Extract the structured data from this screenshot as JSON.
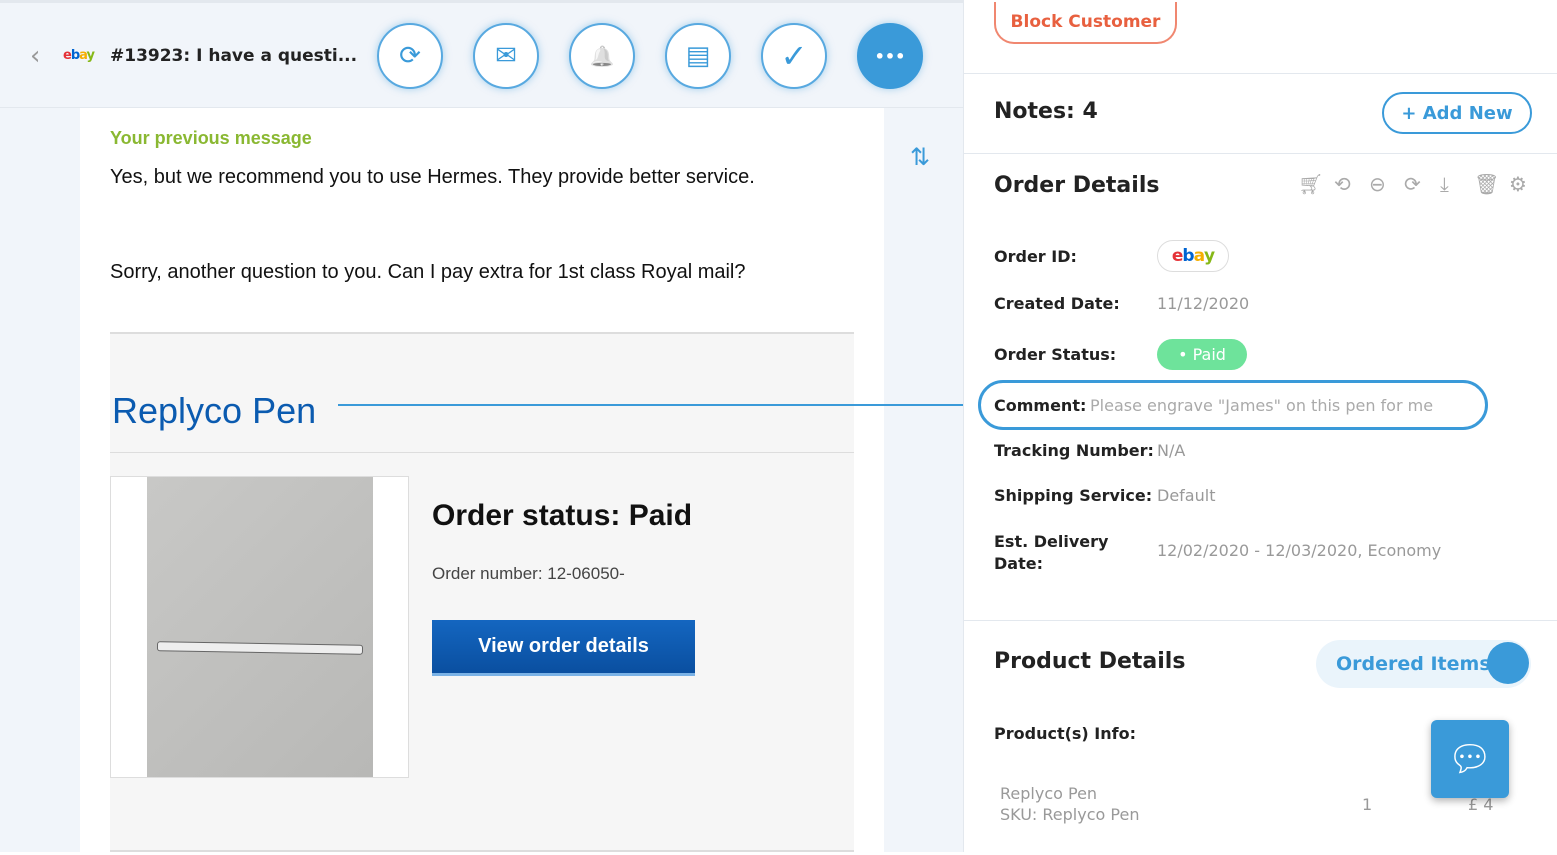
{
  "header": {
    "back": "‹",
    "source": "ebay",
    "title": "#13923: I have a questi...",
    "actions": [
      {
        "name": "refresh",
        "glyph": "⟳"
      },
      {
        "name": "mail",
        "glyph": "✉"
      },
      {
        "name": "snooze",
        "glyph": "🔔"
      },
      {
        "name": "archive",
        "glyph": "▤"
      },
      {
        "name": "resolve",
        "glyph": "✓"
      },
      {
        "name": "reply",
        "glyph": "•••"
      }
    ]
  },
  "message": {
    "previous_label": "Your previous message",
    "previous_text": "Yes, but we recommend you to use Hermes. They provide better service.",
    "new_text": "Sorry, another question to you. Can I pay extra for 1st class Royal mail?",
    "product_title": "Replyco Pen",
    "order_status": "Order status: Paid",
    "order_number": "Order number: 12-06050-",
    "view_button": "View order details",
    "sort_icon": "⇅"
  },
  "sidebar": {
    "block_button": "Block Customer",
    "notes_label": "Notes: 4",
    "add_new": "+ Add New",
    "order_details_title": "Order Details",
    "order_icons": [
      "cart",
      "reorder",
      "exchange",
      "refund",
      "download",
      "delete",
      "settings"
    ],
    "order": {
      "id_label": "Order ID:",
      "id_value": "ebay",
      "created_label": "Created Date:",
      "created_value": "11/12/2020",
      "status_label": "Order Status:",
      "status_value": "• Paid",
      "comment_label": "Comment:",
      "comment_value": "Please engrave \"James\" on this pen for me",
      "tracking_label": "Tracking Number:",
      "tracking_value": "N/A",
      "shipping_label": "Shipping Service:",
      "shipping_value": "Default",
      "delivery_label": "Est. Delivery Date:",
      "delivery_value": "12/02/2020 - 12/03/2020, Economy"
    },
    "product_details_title": "Product Details",
    "ordered_items_toggle": "Ordered Items",
    "products_info_label": "Product(s) Info:",
    "products": [
      {
        "name": "Replyco Pen",
        "sku": "SKU: Replyco Pen",
        "qty": "1",
        "price": "£ 4"
      }
    ]
  },
  "colors": {
    "accent": "#3a9ad9",
    "paid": "#6ee39b",
    "block": "#e8603f",
    "previous": "#8ab832",
    "ebay_blue": "#0b5bb0"
  }
}
